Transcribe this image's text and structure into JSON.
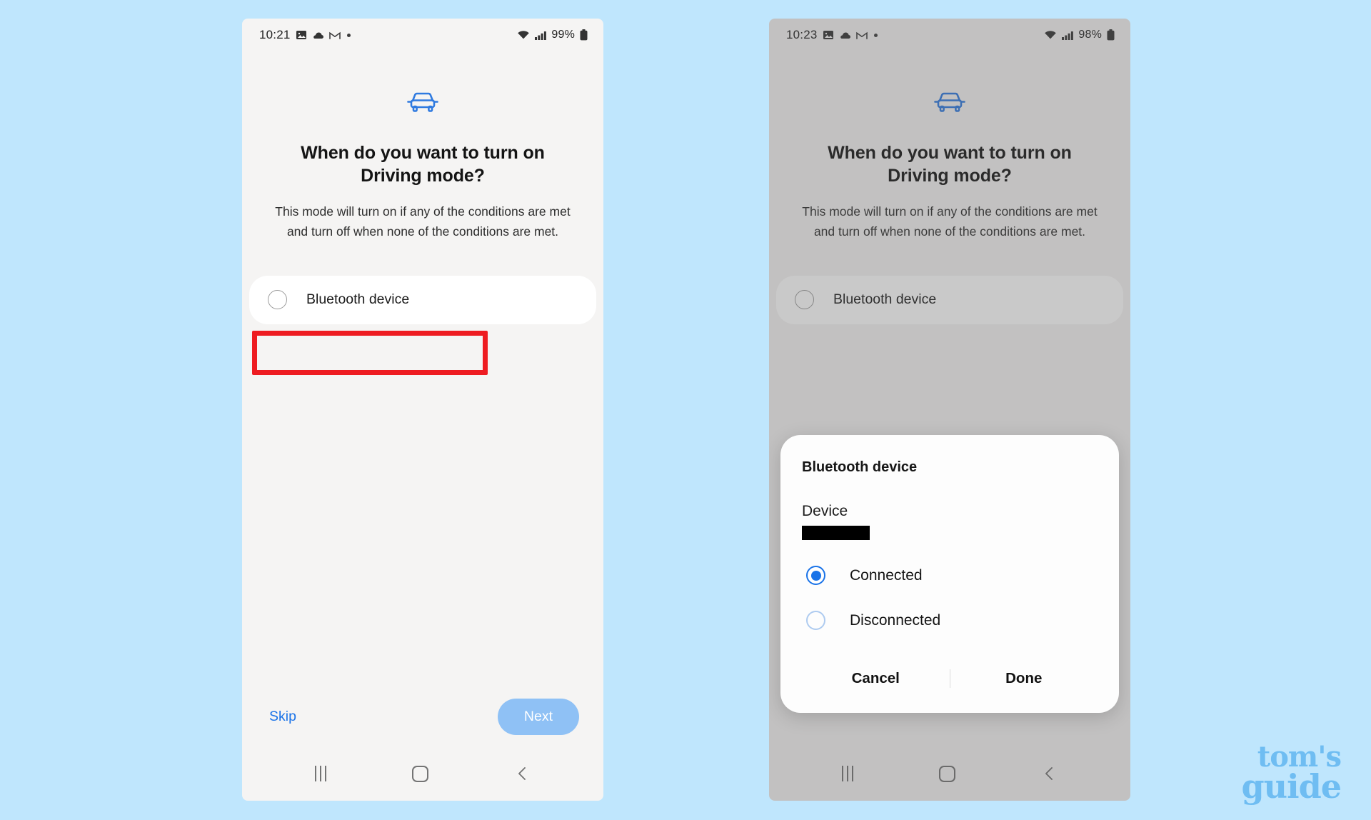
{
  "page": {
    "background_color": "#bfe6fd",
    "watermark_line1": "tom's",
    "watermark_line2": "guide",
    "watermark_color": "#6fbdf2"
  },
  "screens": [
    {
      "id": "left",
      "statusbar": {
        "time": "10:21",
        "battery_percent": "99%",
        "icons": [
          "image-icon",
          "cloud-icon",
          "gmail-icon",
          "dot-icon",
          "wifi-icon",
          "signal-icon",
          "battery-icon"
        ]
      },
      "app_icon": "car-icon",
      "headline": "When do you want to turn on Driving mode?",
      "subtext": "This mode will turn on if any of the conditions are met and turn off when none of the conditions are met.",
      "option": {
        "label": "Bluetooth device",
        "selected": false
      },
      "annotation": {
        "type": "highlight-box",
        "color": "#ee1c21",
        "target": "Bluetooth device"
      },
      "skip_label": "Skip",
      "next_label": "Next",
      "next_enabled": false,
      "navbar": [
        "recents-icon",
        "home-icon",
        "back-icon"
      ]
    },
    {
      "id": "right",
      "dimmed": true,
      "statusbar": {
        "time": "10:23",
        "battery_percent": "98%",
        "icons": [
          "image-icon",
          "cloud-icon",
          "gmail-icon",
          "dot-icon",
          "wifi-icon",
          "signal-icon",
          "battery-icon"
        ]
      },
      "app_icon": "car-icon",
      "headline": "When do you want to turn on Driving mode?",
      "subtext": "This mode will turn on if any of the conditions are met and turn off when none of the conditions are met.",
      "option": {
        "label": "Bluetooth device",
        "selected": false
      },
      "dialog": {
        "title": "Bluetooth device",
        "device_label": "Device",
        "device_value_redacted": true,
        "options": [
          {
            "label": "Connected",
            "selected": true
          },
          {
            "label": "Disconnected",
            "selected": false
          }
        ],
        "cancel_label": "Cancel",
        "done_label": "Done",
        "accent_color": "#1a73e8"
      },
      "navbar": [
        "recents-icon",
        "home-icon",
        "back-icon"
      ]
    }
  ]
}
